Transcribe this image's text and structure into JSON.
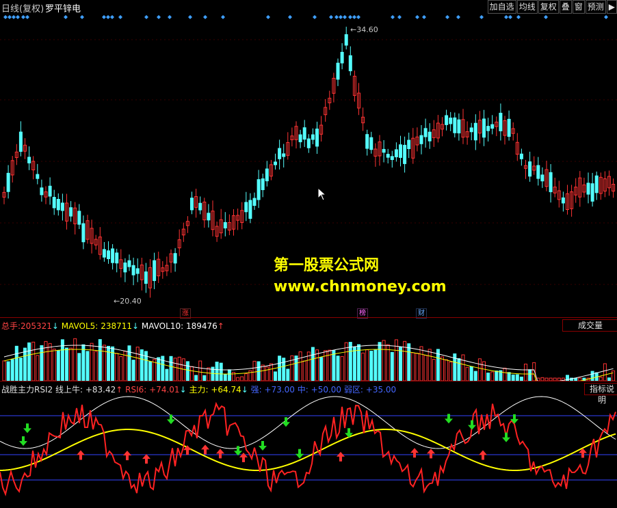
{
  "header": {
    "period": "日线(复权)",
    "stock_name": "罗平锌电",
    "toolbar": [
      "加自选",
      "均线",
      "复权",
      "叠",
      "窗",
      "预测",
      "▶"
    ]
  },
  "price_panel": {
    "high_label": "34.60",
    "low_label": "20.40",
    "markers": [
      {
        "text": "涨",
        "color": "#ff3333"
      },
      {
        "text": "榜",
        "color": "#ff66ff"
      },
      {
        "text": "财",
        "color": "#66aaff"
      }
    ]
  },
  "watermark": {
    "line1": "第一股票公式网",
    "line2": "www.chnmoney.com"
  },
  "volume_panel": {
    "label": "总手:",
    "total": "205321",
    "total_arrow": "↓",
    "mavol5_label": "MAVOL5:",
    "mavol5": "238711",
    "mavol5_arrow": "↓",
    "mavol10_label": "MAVOL10:",
    "mavol10": "189476",
    "mavol10_arrow": "↑",
    "button": "成交量"
  },
  "indicator_panel": {
    "name": "战胜主力RSI2",
    "line_label": "线上牛:",
    "line_value": "+83.42",
    "line_arrow": "↑",
    "rsi_label": "RSI6:",
    "rsi_value": "+74.01",
    "rsi_arrow": "↓",
    "main_label": "主力:",
    "main_value": "+64.74",
    "main_arrow": "↓",
    "strong_label": "强:",
    "strong_value": "+73.00",
    "mid_label": "中:",
    "mid_value": "+50.00",
    "weak_label": "弱区:",
    "weak_value": "+35.00",
    "button": "指标说明"
  },
  "colors": {
    "up": "#ff3333",
    "down": "#54ffff",
    "yellow": "#ffff00",
    "blue": "#3344ff",
    "diamond": "#3fa0ff",
    "separator": "#8b0000"
  }
}
